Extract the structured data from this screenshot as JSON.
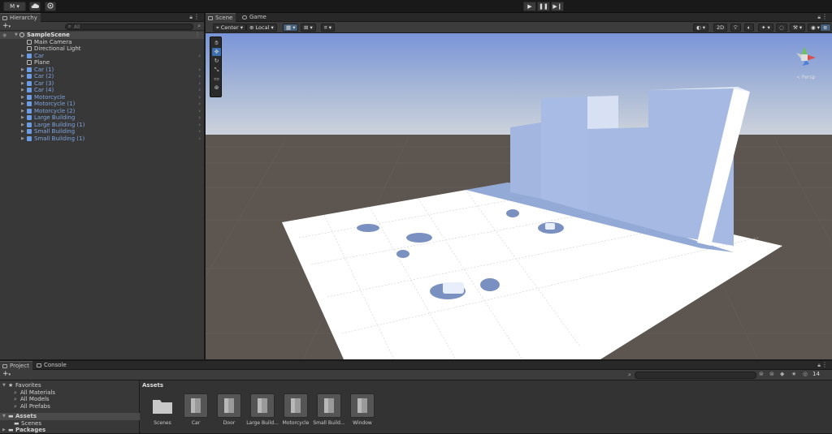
{
  "topbar": {
    "account_label": "M",
    "account_caret": "▾",
    "cloud_icon": "cloud-icon",
    "collab_icon": "history-icon",
    "play_glyph": "▶",
    "pause_glyph": "❚❚",
    "step_glyph": "▶❙"
  },
  "hierarchy": {
    "tab_label": "Hierarchy",
    "add_label": "+",
    "add_caret": "▾",
    "search_placeholder": "All",
    "scene_name": "SampleScene",
    "items": [
      {
        "label": "Main Camera",
        "kind": "camera",
        "prefab": false
      },
      {
        "label": "Directional Light",
        "kind": "light",
        "prefab": false
      },
      {
        "label": "Car",
        "kind": "prefab",
        "prefab": true
      },
      {
        "label": "Plane",
        "kind": "object",
        "prefab": false
      },
      {
        "label": "Car (1)",
        "kind": "prefab",
        "prefab": true
      },
      {
        "label": "Car (2)",
        "kind": "prefab",
        "prefab": true
      },
      {
        "label": "Car (3)",
        "kind": "prefab",
        "prefab": true
      },
      {
        "label": "Car (4)",
        "kind": "prefab",
        "prefab": true
      },
      {
        "label": "Motorcycle",
        "kind": "prefab",
        "prefab": true
      },
      {
        "label": "Motorcycle (1)",
        "kind": "prefab",
        "prefab": true
      },
      {
        "label": "Motorcycle (2)",
        "kind": "prefab",
        "prefab": true
      },
      {
        "label": "Large Building",
        "kind": "prefab",
        "prefab": true
      },
      {
        "label": "Large Building (1)",
        "kind": "prefab",
        "prefab": true
      },
      {
        "label": "Small Building",
        "kind": "prefab",
        "prefab": true
      },
      {
        "label": "Small Building (1)",
        "kind": "prefab",
        "prefab": true
      }
    ]
  },
  "scene": {
    "tabs": [
      {
        "label": "Scene"
      },
      {
        "label": "Game"
      }
    ],
    "pivot_label": "Center",
    "space_label": "Local",
    "mode_2d_label": "2D",
    "persp_label": "< Persp"
  },
  "project": {
    "tabs": [
      {
        "label": "Project"
      },
      {
        "label": "Console"
      }
    ],
    "add_label": "+",
    "add_caret": "▾",
    "hidden_count": "14",
    "tree": {
      "favorites": "Favorites",
      "favorite_items": [
        "All Materials",
        "All Models",
        "All Prefabs"
      ],
      "assets": "Assets",
      "asset_items": [
        "Scenes"
      ],
      "packages": "Packages"
    },
    "breadcrumb": "Assets",
    "assets": [
      {
        "name": "Scenes",
        "kind": "folder"
      },
      {
        "name": "Car",
        "kind": "model"
      },
      {
        "name": "Door",
        "kind": "model"
      },
      {
        "name": "Large Build...",
        "kind": "model"
      },
      {
        "name": "Motorcycle",
        "kind": "model"
      },
      {
        "name": "Small Build...",
        "kind": "model"
      },
      {
        "name": "Window",
        "kind": "model"
      }
    ]
  },
  "colors": {
    "accent": "#46607c",
    "prefab_text": "#7fa6e0",
    "sky_top": "#7a95d8",
    "ground": "#5d5650",
    "plane": "#ffffff",
    "building": "#b3c3e6"
  }
}
